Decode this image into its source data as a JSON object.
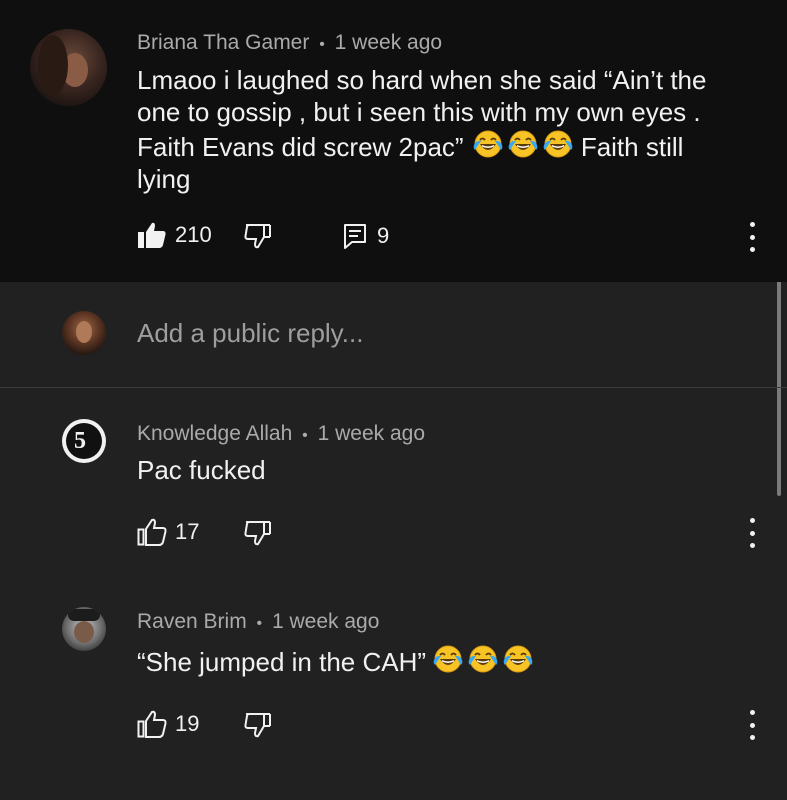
{
  "comments": [
    {
      "author": "Briana Tha Gamer",
      "time": "1 week ago",
      "text_lines": [
        "Lmaoo i laughed so hard when she said “Ain’t the",
        "one to gossip , but i seen this with my own eyes .",
        "Faith Evans did screw 2pac”",
        " Faith still",
        "lying"
      ],
      "likes": "210",
      "replies": "9",
      "liked": true
    },
    {
      "author": "Knowledge Allah",
      "time": "1 week ago",
      "text": "Pac fucked",
      "likes": "17"
    },
    {
      "author": "Raven Brim",
      "time": "1 week ago",
      "text": "“She jumped in the CAH”",
      "likes": "19"
    }
  ],
  "reply_box": {
    "placeholder": "Add a public reply..."
  },
  "separator": "•",
  "icons": {
    "like": "thumbs-up-icon",
    "dislike": "thumbs-down-icon",
    "reply": "comment-icon",
    "more": "more-vertical-icon",
    "emoji": "face-with-tears-of-joy-emoji"
  },
  "colors": {
    "main_bg": "#0f0f0f",
    "page_bg": "#212121",
    "text": "#f1f1f1",
    "meta": "#aaaaaa"
  }
}
